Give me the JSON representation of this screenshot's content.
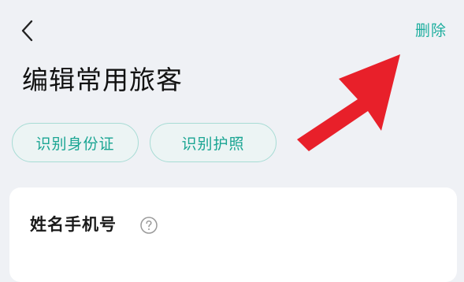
{
  "header": {
    "back_icon": "chevron-left-icon",
    "delete_label": "删除",
    "accent_color": "#1dae9e"
  },
  "page": {
    "title": "编辑常用旅客"
  },
  "actions": {
    "scan_id_label": "识别身份证",
    "scan_passport_label": "识别护照"
  },
  "card": {
    "name_phone_label": "姓名手机号",
    "help_icon": "question-circle-icon"
  },
  "annotation": {
    "arrow_color": "#e8202a",
    "points_to": "delete-link"
  }
}
